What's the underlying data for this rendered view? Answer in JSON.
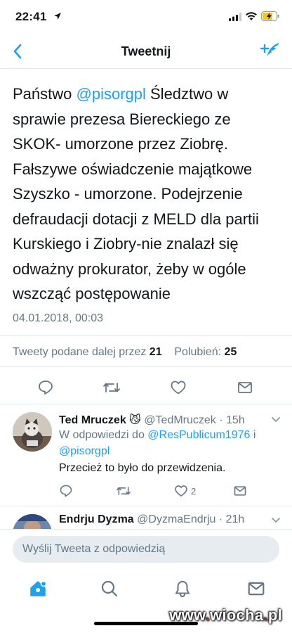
{
  "status_bar": {
    "time": "22:41"
  },
  "nav": {
    "title": "Tweetnij",
    "back_icon": "chevron-left-icon",
    "compose_icon": "compose-tweet-icon"
  },
  "tweet": {
    "lines": [
      {
        "pre": "Państwo ",
        "mention": "@pisorgpl",
        "post": " Śledztwo w"
      },
      {
        "text": "sprawie prezesa Biereckiego ze"
      },
      {
        "text": "SKOK- umorzone przez Ziobrę."
      },
      {
        "text": "Fałszywe oświadczenie majątkowe"
      },
      {
        "text": "Szyszko - umorzone. Podejrzenie"
      },
      {
        "text": "defraudacji dotacji z MELD dla partii"
      },
      {
        "text": "Kurskiego i Ziobry-nie znalazł się"
      },
      {
        "text": "odważny prokurator, żeby w ogóle"
      },
      {
        "text": "wszcząć postępowanie"
      }
    ],
    "date": "04.01.2018, 00:03",
    "stats": {
      "retweets_label": "Tweety podane dalej przez",
      "retweets": "21",
      "likes_label": "Polubień:",
      "likes": "25"
    }
  },
  "replies": [
    {
      "name": "Ted Mruczek 😼",
      "handle": "@TedMruczek · 15h",
      "in_reply_prefix": "W odpowiedzi do ",
      "in_reply_to_1": "@ResPublicum1976",
      "in_reply_conj": " i",
      "in_reply_to_2": "@pisorgpl",
      "text": "Przecież to było do przewidzenia.",
      "like_count": "2"
    },
    {
      "name": "Endrju Dyzma",
      "handle": "@DyzmaEndrju · 21h"
    }
  ],
  "composer": {
    "placeholder": "Wyślij Tweeta z odpowiedzią"
  },
  "tabs": [
    "home-icon",
    "search-icon",
    "notifications-bell-icon",
    "messages-envelope-icon"
  ],
  "watermark": {
    "pre": "www",
    "dot1": ".",
    "mid": "wiocha",
    "dot2": ".",
    "post": "pl"
  },
  "colors": {
    "accent": "#1da1f2",
    "text": "#14171a",
    "muted": "#657786",
    "divider": "#e1e8ed"
  }
}
